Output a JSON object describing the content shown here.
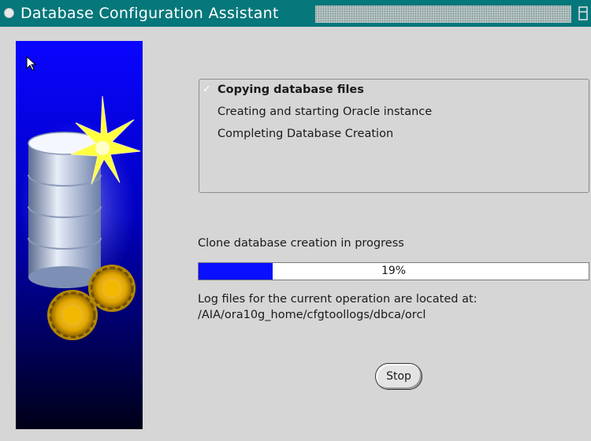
{
  "window": {
    "title": "Database Configuration Assistant"
  },
  "steps": [
    {
      "label": "Copying database files",
      "state": "in-progress"
    },
    {
      "label": "Creating and starting Oracle instance",
      "state": "pending"
    },
    {
      "label": "Completing Database Creation",
      "state": "pending"
    }
  ],
  "progress": {
    "status": "Clone database creation in progress",
    "percent": 19,
    "label": "19%"
  },
  "log": {
    "line1": "Log files for the current operation are located at:",
    "line2": "/AIA/ora10g_home/cfgtoollogs/dbca/orcl"
  },
  "buttons": {
    "stop": "Stop"
  },
  "colors": {
    "titlebar": "#06777a",
    "progress_fill": "#0a0fff",
    "side_panel": "#0000c8"
  },
  "icons": [
    "window-menu-icon",
    "database-icon",
    "star-icon",
    "gears-icon",
    "mouse-cursor-icon",
    "check-icon"
  ]
}
